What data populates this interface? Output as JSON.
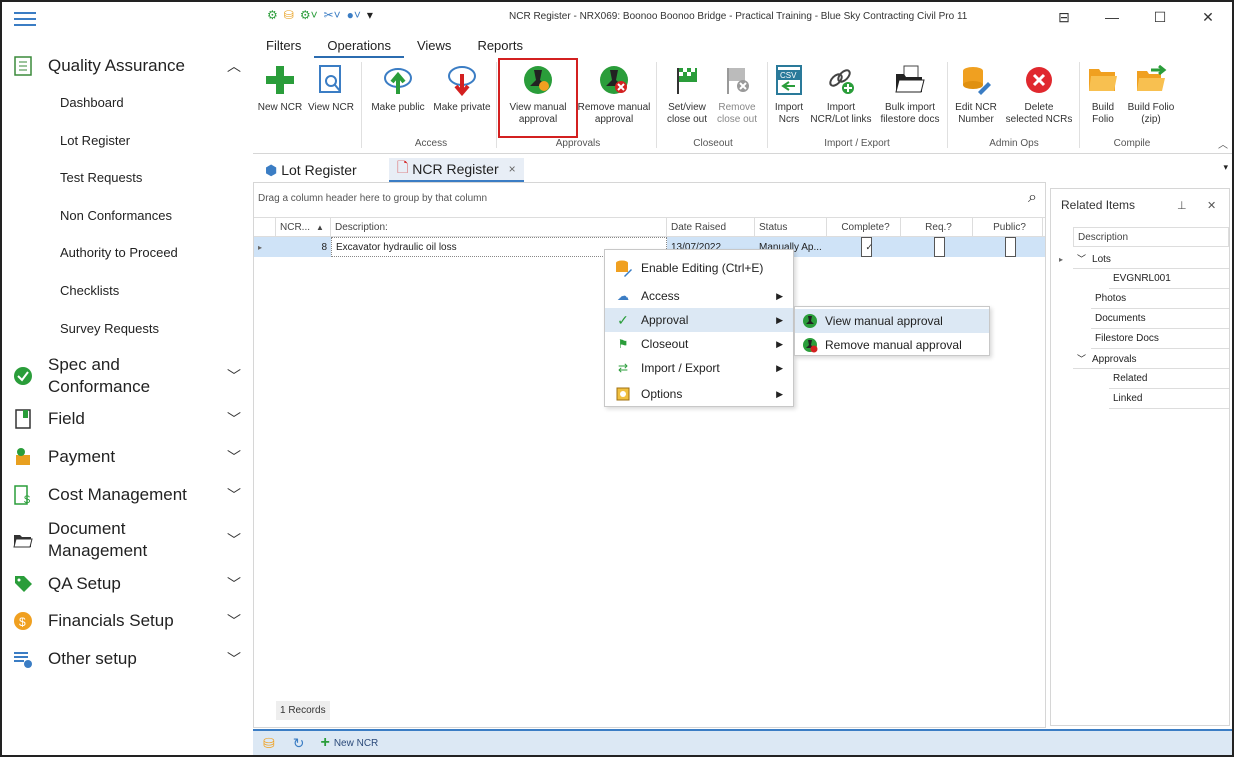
{
  "window": {
    "title": "NCR Register - NRX069: Boonoo Boonoo Bridge - Practical Training - Blue Sky Contracting Civil Pro 11"
  },
  "sidebar": {
    "quality_assurance": "Quality Assurance",
    "items": [
      "Dashboard",
      "Lot Register",
      "Test Requests",
      "Non Conformances",
      "Authority to Proceed",
      "Checklists",
      "Survey Requests"
    ],
    "sections": {
      "spec1": "Spec and",
      "spec2": "Conformance",
      "field": "Field",
      "payment": "Payment",
      "cost": "Cost Management",
      "doc1": "Document",
      "doc2": "Management",
      "qa_setup": "QA Setup",
      "fin_setup": "Financials Setup",
      "other": "Other setup"
    }
  },
  "ribbon": {
    "tabs": [
      "Filters",
      "Operations",
      "Views",
      "Reports"
    ],
    "buttons": {
      "new_ncr": "New NCR",
      "view_ncr": "View NCR",
      "make_public": "Make public",
      "make_private": "Make private",
      "view_manual_1": "View manual",
      "view_manual_2": "approval",
      "remove_manual_1": "Remove manual",
      "remove_manual_2": "approval",
      "setview_1": "Set/view",
      "setview_2": "close out",
      "remove_co_1": "Remove",
      "remove_co_2": "close out",
      "import_1": "Import",
      "import_2": "Ncrs",
      "import_links_1": "Import",
      "import_links_2": "NCR/Lot links",
      "bulk_1": "Bulk import",
      "bulk_2": "filestore docs",
      "edit_1": "Edit NCR",
      "edit_2": "Number",
      "delete_1": "Delete",
      "delete_2": "selected NCRs",
      "build_1": "Build",
      "build_2": "Folio",
      "buildzip_1": "Build Folio",
      "buildzip_2": "(zip)"
    },
    "groups": {
      "access": "Access",
      "approvals": "Approvals",
      "closeout": "Closeout",
      "import_export": "Import / Export",
      "admin": "Admin Ops",
      "compile": "Compile"
    }
  },
  "doctabs": {
    "lot": "Lot Register",
    "ncr": "NCR Register",
    "close": "×"
  },
  "grid": {
    "group_hint": "Drag a column header here to group by that column",
    "columns": [
      "NCR...",
      "Description:",
      "Date Raised",
      "Status",
      "Complete?",
      "Req.?",
      "Public?"
    ],
    "row": {
      "ncr": "8",
      "description": "Excavator hydraulic oil loss",
      "date": "13/07/2022",
      "status": "Manually Ap...",
      "complete": true,
      "req": false,
      "public": false
    },
    "records": "1 Records"
  },
  "related": {
    "title": "Related Items",
    "header": "Description",
    "rows": {
      "lots": "Lots",
      "lot1": "EVGNRL001",
      "photos": "Photos",
      "documents": "Documents",
      "filestore": "Filestore Docs",
      "approvals": "Approvals",
      "related": "Related",
      "linked": "Linked"
    }
  },
  "context_menu": {
    "items": [
      "Enable Editing (Ctrl+E)",
      "Access",
      "Approval",
      "Closeout",
      "Import / Export",
      "Options"
    ],
    "submenu": [
      "View manual approval",
      "Remove manual approval"
    ]
  },
  "bottombar": {
    "new_ncr": "New NCR"
  },
  "colors": {
    "accent": "#3b7dc4",
    "highlight": "#d32020",
    "selected_row": "#cfe3f7"
  }
}
